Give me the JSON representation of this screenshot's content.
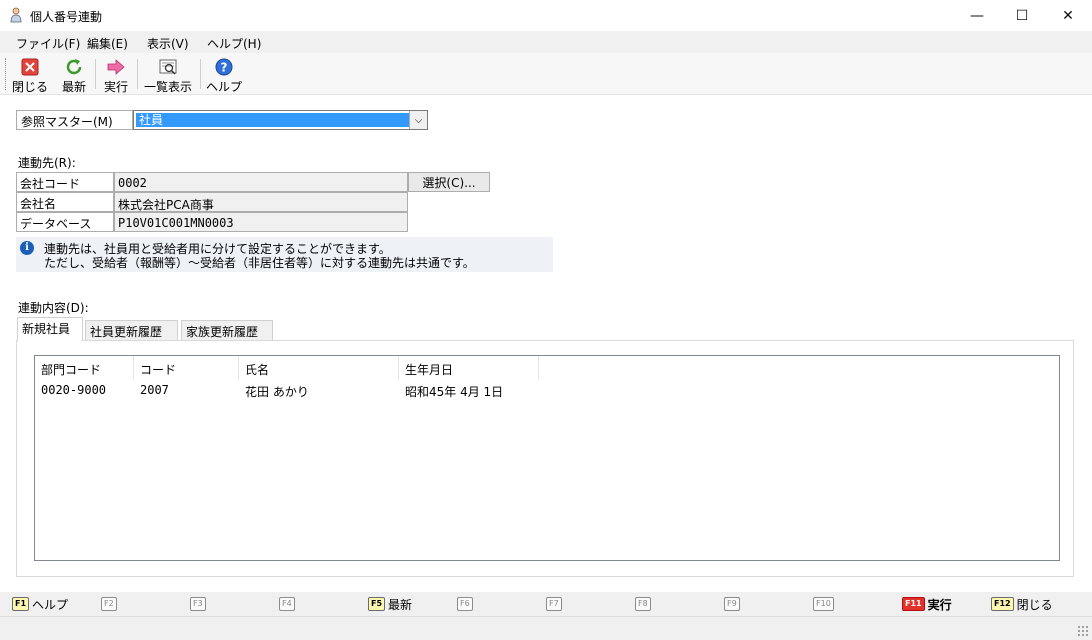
{
  "window": {
    "title": "個人番号連動",
    "minimize_glyph": "—",
    "maximize_glyph": "☐",
    "close_glyph": "✕"
  },
  "menu": [
    "ファイル(F)",
    "編集(E)",
    "表示(V)",
    "ヘルプ(H)"
  ],
  "toolbar": {
    "close": "閉じる",
    "refresh": "最新",
    "execute": "実行",
    "list_view": "一覧表示",
    "help": "ヘルプ"
  },
  "master": {
    "label": "参照マスター(M)",
    "selected": "社員",
    "arrow": "⌵"
  },
  "destination": {
    "label": "連動先(R):",
    "rows": [
      {
        "key": "会社コード",
        "value": "0002"
      },
      {
        "key": "会社名",
        "value": "株式会社PCA商事"
      },
      {
        "key": "データベース",
        "value": "P10V01C001MN0003"
      }
    ],
    "select_button": "選択(C)..."
  },
  "info": {
    "icon": "i",
    "line1": "連動先は、社員用と受給者用に分けて設定することができます。",
    "line2": "ただし、受給者（報酬等）～受給者（非居住者等）に対する連動先は共通です。"
  },
  "content": {
    "label": "連動内容(D):",
    "tabs": [
      "新規社員",
      "社員更新履歴",
      "家族更新履歴"
    ],
    "columns": [
      "部門コード",
      "コード",
      "氏名",
      "生年月日"
    ],
    "rows": [
      [
        "0020-9000",
        "2007",
        "花田 あかり",
        "昭和45年 4月 1日"
      ]
    ]
  },
  "fkeys": [
    {
      "key": "F1",
      "label": "ヘルプ"
    },
    {
      "key": "F2",
      "label": ""
    },
    {
      "key": "F3",
      "label": ""
    },
    {
      "key": "F4",
      "label": ""
    },
    {
      "key": "F5",
      "label": "最新"
    },
    {
      "key": "F6",
      "label": ""
    },
    {
      "key": "F7",
      "label": ""
    },
    {
      "key": "F8",
      "label": ""
    },
    {
      "key": "F9",
      "label": ""
    },
    {
      "key": "F10",
      "label": ""
    },
    {
      "key": "F11",
      "label": "実行"
    },
    {
      "key": "F12",
      "label": "閉じる"
    }
  ],
  "colors": {
    "selection": "#3399ff",
    "fkey_active": "#fff8b0",
    "fkey_execute": "#e4322b"
  }
}
